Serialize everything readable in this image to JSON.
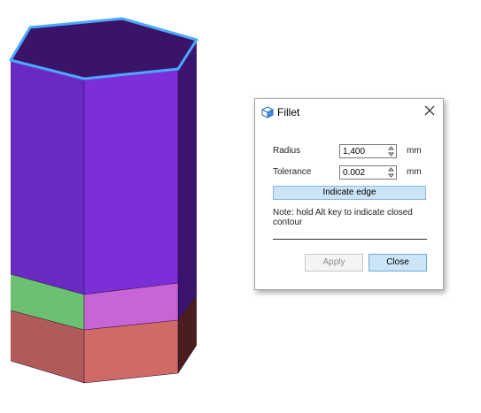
{
  "viewport": {
    "model": "hexagonal-prism",
    "colors": {
      "top_face": "#3a1468",
      "selected_edge": "#4aa8ff",
      "front_upper": "#7c2fd8",
      "left_upper": "#6a2ac2",
      "right_upper": "#3b1470",
      "front_middle": "#c865d6",
      "left_middle": "#6cc072",
      "right_middle": "#3b1470",
      "front_lower": "#cf6a66",
      "left_lower": "#b15a5a",
      "right_lower": "#4a1e1e"
    }
  },
  "dialog": {
    "title": "Fillet",
    "icon": "cube-icon",
    "radius": {
      "label": "Radius",
      "value": "1,400",
      "unit": "mm"
    },
    "tolerance": {
      "label": "Tolerance",
      "value": "0.002",
      "unit": "mm"
    },
    "indicate_edge_label": "Indicate edge",
    "note": "Note: hold Alt key to indicate closed contour",
    "apply_label": "Apply",
    "close_label": "Close",
    "colors": {
      "accent": "#cce4f7",
      "accent_border": "#6fa9dc",
      "disabled_text": "#8c8c8c"
    }
  }
}
